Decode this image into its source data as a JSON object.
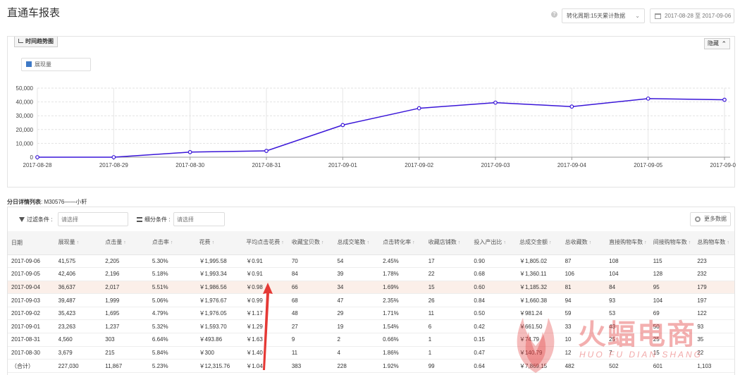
{
  "header": {
    "title": "直通车报表",
    "help_icon": "?",
    "cycle_select": "转化周期:15天累计数据",
    "date_start": "2017-08-28",
    "date_sep": "至",
    "date_end": "2017-09-06"
  },
  "chart_panel": {
    "tab_label": "时间趋势图",
    "hide_label": "隐藏",
    "legend_label": "展现量"
  },
  "chart_data": {
    "type": "line",
    "x": [
      "2017-08-28",
      "2017-08-29",
      "2017-08-30",
      "2017-08-31",
      "2017-09-01",
      "2017-09-02",
      "2017-09-03",
      "2017-09-04",
      "2017-09-05",
      "2017-09-06"
    ],
    "series": [
      {
        "name": "展现量",
        "values": [
          0,
          0,
          3679,
          4560,
          23263,
          35423,
          39487,
          36637,
          42406,
          41575
        ]
      }
    ],
    "y_ticks": [
      "50,000",
      "40,000",
      "30,000",
      "20,000",
      "10,000",
      "0"
    ],
    "ylim": [
      0,
      50000
    ],
    "grid": true,
    "line_color": "#3a16d8"
  },
  "section": {
    "label_bold": "分日详情列表",
    "label_rest": ": M30576——小轩"
  },
  "filters": {
    "filter_label": "过滤条件 :",
    "filter_placeholder": "请选择",
    "segment_label": "细分条件 :",
    "segment_placeholder": "请选择",
    "more_label": "更多数据"
  },
  "table": {
    "sort_mark": "↑",
    "columns": [
      "日期",
      "展现量",
      "点击量",
      "点击率",
      "花费",
      "平均点击花费",
      "收藏宝贝数",
      "总成交笔数",
      "点击转化率",
      "收藏店铺数",
      "投入产出比",
      "总成交金额",
      "总收藏数",
      "直接购物车数",
      "间接购物车数",
      "总购物车数"
    ],
    "sortable": [
      false,
      true,
      true,
      true,
      true,
      true,
      true,
      true,
      true,
      true,
      true,
      true,
      true,
      true,
      true,
      true
    ],
    "rows": [
      [
        "2017-09-06",
        "41,575",
        "2,205",
        "5.30%",
        "￥1,995.58",
        "￥0.91",
        "70",
        "54",
        "2.45%",
        "17",
        "0.90",
        "￥1,805.02",
        "87",
        "108",
        "115",
        "223"
      ],
      [
        "2017-09-05",
        "42,406",
        "2,196",
        "5.18%",
        "￥1,993.34",
        "￥0.91",
        "84",
        "39",
        "1.78%",
        "22",
        "0.68",
        "￥1,360.11",
        "106",
        "104",
        "128",
        "232"
      ],
      [
        "2017-09-04",
        "36,637",
        "2,017",
        "5.51%",
        "￥1,986.56",
        "￥0.98",
        "66",
        "34",
        "1.69%",
        "15",
        "0.60",
        "￥1,185.32",
        "81",
        "84",
        "95",
        "179"
      ],
      [
        "2017-09-03",
        "39,487",
        "1,999",
        "5.06%",
        "￥1,976.67",
        "￥0.99",
        "68",
        "47",
        "2.35%",
        "26",
        "0.84",
        "￥1,660.38",
        "94",
        "93",
        "104",
        "197"
      ],
      [
        "2017-09-02",
        "35,423",
        "1,695",
        "4.79%",
        "￥1,976.05",
        "￥1.17",
        "48",
        "29",
        "1.71%",
        "11",
        "0.50",
        "￥981.24",
        "59",
        "53",
        "69",
        "122"
      ],
      [
        "2017-09-01",
        "23,263",
        "1,237",
        "5.32%",
        "￥1,593.70",
        "￥1.29",
        "27",
        "19",
        "1.54%",
        "6",
        "0.42",
        "￥661.50",
        "33",
        "43",
        "50",
        "93"
      ],
      [
        "2017-08-31",
        "4,560",
        "303",
        "6.64%",
        "￥493.86",
        "￥1.63",
        "9",
        "2",
        "0.66%",
        "1",
        "0.15",
        "￥74.79",
        "10",
        "25",
        "25",
        "35"
      ],
      [
        "2017-08-30",
        "3,679",
        "215",
        "5.84%",
        "￥300",
        "￥1.40",
        "11",
        "4",
        "1.86%",
        "1",
        "0.47",
        "￥140.79",
        "12",
        "7",
        "15",
        "22"
      ],
      [
        "（合计）",
        "227,030",
        "11,867",
        "5.23%",
        "￥12,315.76",
        "￥1.04",
        "383",
        "228",
        "1.92%",
        "99",
        "0.64",
        "￥7,869.15",
        "482",
        "502",
        "601",
        "1,103"
      ]
    ],
    "highlight_row": 2
  },
  "watermark": {
    "main": "火蝠电商",
    "sub": "HUO FU DIAN SHANG"
  }
}
